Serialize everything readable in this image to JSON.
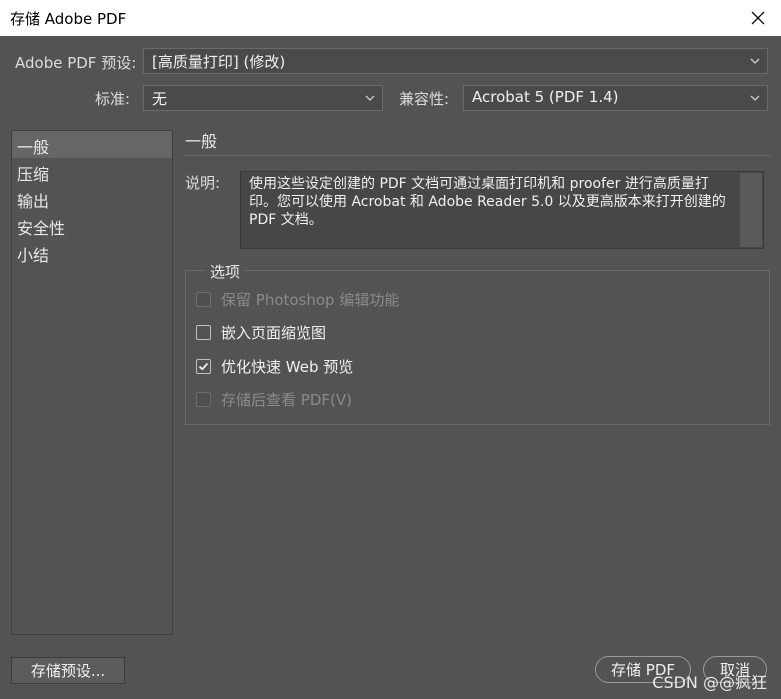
{
  "window": {
    "title": "存储 Adobe PDF"
  },
  "preset": {
    "label": "Adobe PDF 预设:",
    "value": "[高质量打印] (修改)"
  },
  "standard": {
    "label": "标准:",
    "value": "无"
  },
  "compat": {
    "label": "兼容性:",
    "value": "Acrobat 5 (PDF 1.4)"
  },
  "categories": [
    "一般",
    "压缩",
    "输出",
    "安全性",
    "小结"
  ],
  "active_category_index": 0,
  "section": {
    "title": "一般",
    "desc_label": "说明:",
    "desc_text": "使用这些设定创建的 PDF 文档可通过桌面打印机和 proofer 进行高质量打印。您可以使用 Acrobat 和 Adobe Reader 5.0 以及更高版本来打开创建的 PDF 文档。"
  },
  "options": {
    "legend": "选项",
    "items": [
      {
        "label": "保留 Photoshop 编辑功能",
        "checked": false,
        "enabled": false
      },
      {
        "label": "嵌入页面缩览图",
        "checked": false,
        "enabled": true
      },
      {
        "label": "优化快速 Web 预览",
        "checked": true,
        "enabled": true
      },
      {
        "label": "存储后查看 PDF(V)",
        "checked": false,
        "enabled": false
      }
    ]
  },
  "buttons": {
    "save_preset": "存储预设...",
    "save_pdf": "存储 PDF",
    "cancel": "取消"
  },
  "watermark": "CSDN @@疯狂",
  "colors": {
    "background": "#535353",
    "titlebar": "#ffffff"
  }
}
